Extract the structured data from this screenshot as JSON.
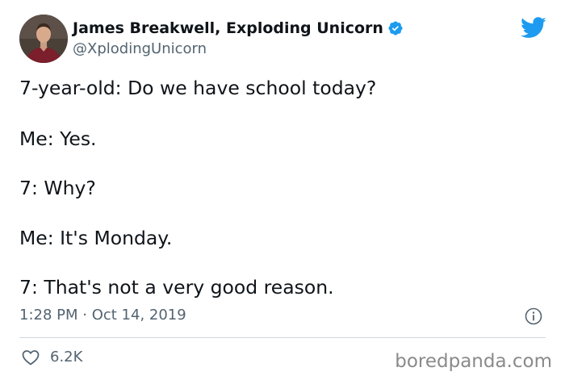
{
  "author": {
    "display_name": "James Breakwell, Exploding Unicorn",
    "handle": "@XplodingUnicorn",
    "avatar": "avatar-photo",
    "verified_icon": "verified-badge-icon"
  },
  "platform_icon": "twitter-bird-icon",
  "tweet": {
    "lines": [
      "7-year-old: Do we have school today?",
      "Me: Yes.",
      "7: Why?",
      "Me: It's Monday.",
      "7: That's not a very good reason."
    ],
    "timestamp": "1:28 PM · Oct 14, 2019"
  },
  "actions": {
    "like_icon": "heart-icon",
    "like_count": "6.2K",
    "info_icon": "info-icon"
  },
  "watermark": "boredpanda.com",
  "colors": {
    "twitter_blue": "#1d9bf0",
    "text_primary": "#0f1419",
    "text_secondary": "#536471",
    "divider": "#cfd9de"
  }
}
